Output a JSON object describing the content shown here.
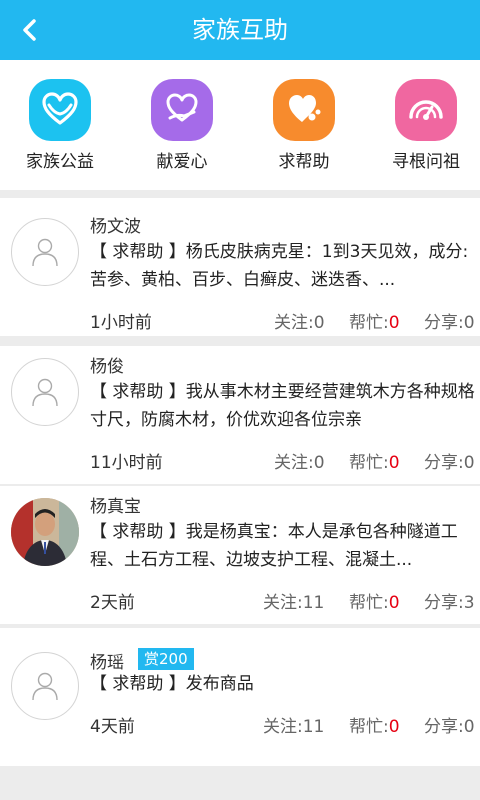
{
  "header": {
    "title": "家族互助"
  },
  "quick_actions": [
    {
      "label": "家族公益",
      "icon": "heart-hands-icon",
      "color": "#1cc2f0"
    },
    {
      "label": "献爱心",
      "icon": "heart-hand-icon",
      "color": "#a56be9"
    },
    {
      "label": "求帮助",
      "icon": "heart-bubble-icon",
      "color": "#f78b2d"
    },
    {
      "label": "寻根问祖",
      "icon": "ancestry-fan-icon",
      "color": "#f067a0"
    }
  ],
  "stat_labels": {
    "follow": "关注:",
    "help": "帮忙:",
    "share": "分享:"
  },
  "posts": [
    {
      "name": "杨文波",
      "content": "【 求帮助 】杨氏皮肤病克星：1到3天见效，成分:苦参、黄柏、百步、白癣皮、迷迭香、...",
      "time": "1小时前",
      "follow": "0",
      "help": "0",
      "share": "0"
    },
    {
      "name": "杨俊",
      "content": "【 求帮助 】我从事木材主要经营建筑木方各种规格寸尺，防腐木材，价优欢迎各位宗亲",
      "time": "11小时前",
      "follow": "0",
      "help": "0",
      "share": "0"
    },
    {
      "name": "杨真宝",
      "content": "【 求帮助 】我是杨真宝：本人是承包各种隧道工程、土石方工程、边坡支护工程、混凝土...",
      "time": "2天前",
      "follow": "11",
      "help": "0",
      "share": "3"
    },
    {
      "name": "杨瑶",
      "badge": "赏200",
      "content": "【 求帮助 】发布商品",
      "time": "4天前",
      "follow": "11",
      "help": "0",
      "share": "0"
    }
  ]
}
